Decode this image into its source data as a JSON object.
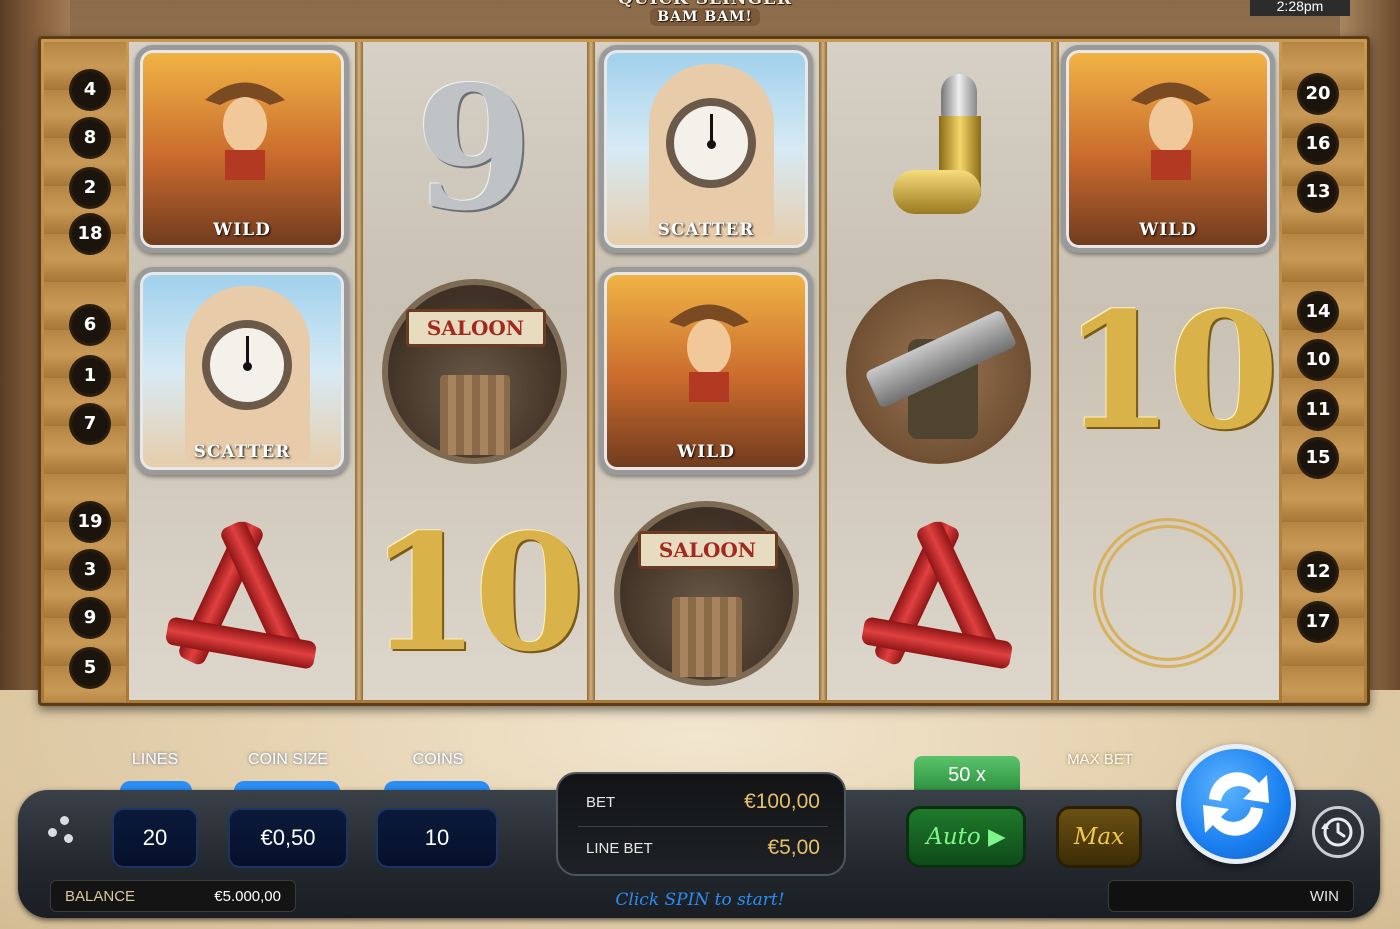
{
  "game": {
    "logo_line1": "QUICK SLINGER",
    "logo_line2": "BAM BAM!",
    "clock": "2:28pm"
  },
  "paylines": {
    "left": [
      "4",
      "8",
      "2",
      "18",
      "6",
      "1",
      "7",
      "19",
      "3",
      "9",
      "5"
    ],
    "right": [
      "20",
      "16",
      "13",
      "14",
      "10",
      "11",
      "15",
      "12",
      "17"
    ]
  },
  "reels": [
    [
      "wild",
      "scatter",
      "tnt"
    ],
    [
      "nine",
      "saloon",
      "ten"
    ],
    [
      "scatter",
      "wild",
      "saloon"
    ],
    [
      "bullet",
      "pistols",
      "tnt"
    ],
    [
      "wild",
      "ten",
      "lasso"
    ]
  ],
  "symbols": {
    "wild_label": "WILD",
    "scatter_label": "SCATTER",
    "saloon_label": "SALOON",
    "nine_glyph": "9",
    "ten_glyph": "10"
  },
  "controls": {
    "lines_label": "LINES",
    "lines_value": "20",
    "coin_size_label": "COIN SIZE",
    "coin_size_value": "€0,50",
    "coins_label": "COINS",
    "coins_value": "10",
    "balance_label": "BALANCE",
    "balance_value": "€5.000,00",
    "bet_label": "BET",
    "bet_value": "€100,00",
    "line_bet_label": "LINE BET",
    "line_bet_value": "€5,00",
    "hint": "Click SPIN to start!",
    "multiplier": "50 x",
    "auto_label": "Auto ▶",
    "max_bet_label": "MAX BET",
    "max_label": "Max",
    "win_label": "WIN"
  },
  "colors": {
    "accent_blue": "#2a8ef5",
    "bet_gold": "#e5c06a",
    "auto_green": "#1f7a2c",
    "max_gold": "#f2c94a"
  },
  "icons": {
    "menu": "menu-dots-icon",
    "spin": "spin-arrows-icon",
    "history": "history-clock-icon"
  }
}
